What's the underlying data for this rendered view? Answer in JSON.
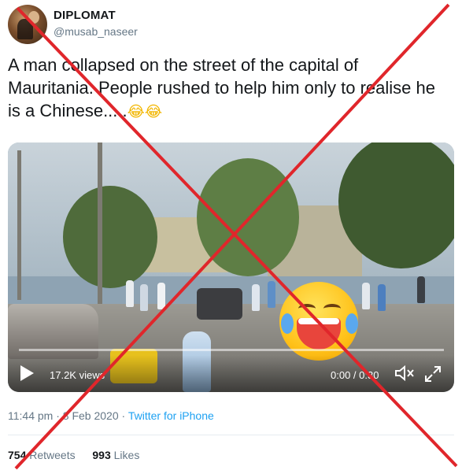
{
  "user": {
    "display_name": "DIPLOMAT",
    "handle": "@musab_naseer"
  },
  "tweet": {
    "text": "A man collapsed on the street of the capital of Mauritania. People rushed to help him only to realise he is a Chinese.....",
    "emoji": "😂😂"
  },
  "video": {
    "views": "17.2K views",
    "time": "0:00 / 0:30",
    "overlay_emoji": "face-with-tears-of-joy"
  },
  "meta": {
    "time": "11:44 pm",
    "separator": " · ",
    "date": "8 Feb 2020",
    "source": "Twitter for iPhone"
  },
  "stats": {
    "retweets_count": "754",
    "retweets_label": "Retweets",
    "likes_count": "993",
    "likes_label": "Likes"
  },
  "colors": {
    "cross": "#e0262b",
    "link": "#1da1f2",
    "muted": "#657786"
  }
}
